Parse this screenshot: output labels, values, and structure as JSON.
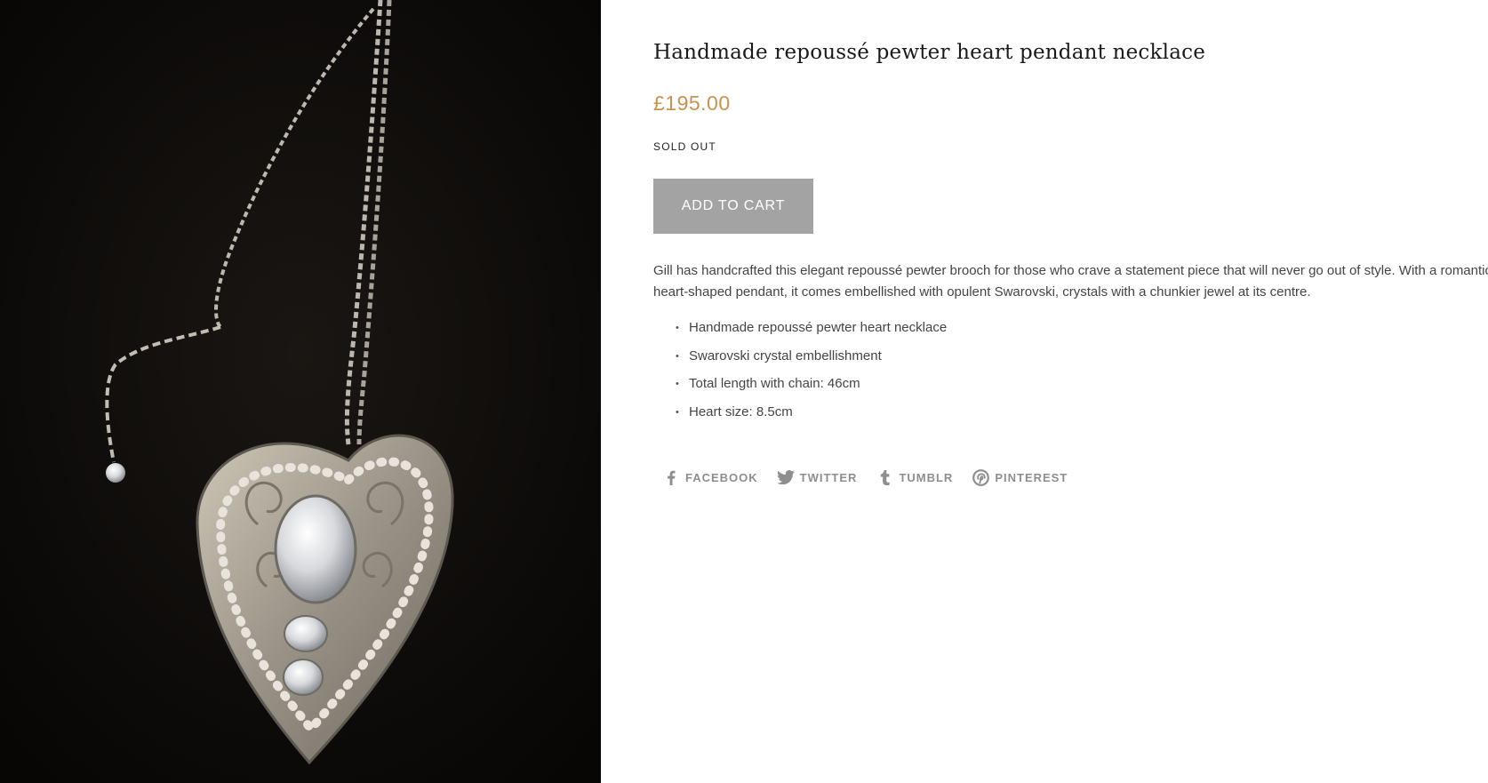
{
  "product": {
    "title": "Handmade repoussé pewter heart pendant necklace",
    "price": "£195.00",
    "stock_status": "SOLD OUT",
    "add_to_cart_label": "ADD TO CART",
    "description_lines": [
      "Gill has handcrafted this elegant repoussé pewter brooch for those who crave a statement piece that will never go out of style. With a romantic",
      "heart-shaped pendant, it comes embellished with opulent Swarovski, crystals with a chunkier jewel at its centre."
    ],
    "features": [
      "Handmade repoussé pewter heart necklace",
      "Swarovski crystal embellishment",
      "Total length with chain: 46cm",
      "Heart size: 8.5cm"
    ]
  },
  "share": [
    {
      "label": "FACEBOOK",
      "icon": "facebook-icon"
    },
    {
      "label": "TWITTER",
      "icon": "twitter-icon"
    },
    {
      "label": "TUMBLR",
      "icon": "tumblr-icon"
    },
    {
      "label": "PINTEREST",
      "icon": "pinterest-icon"
    }
  ],
  "colors": {
    "price": "#c9924f",
    "button_bg": "#a3a3a3",
    "share_text": "#8e8e8e",
    "image_bg": "#0c0a09"
  }
}
